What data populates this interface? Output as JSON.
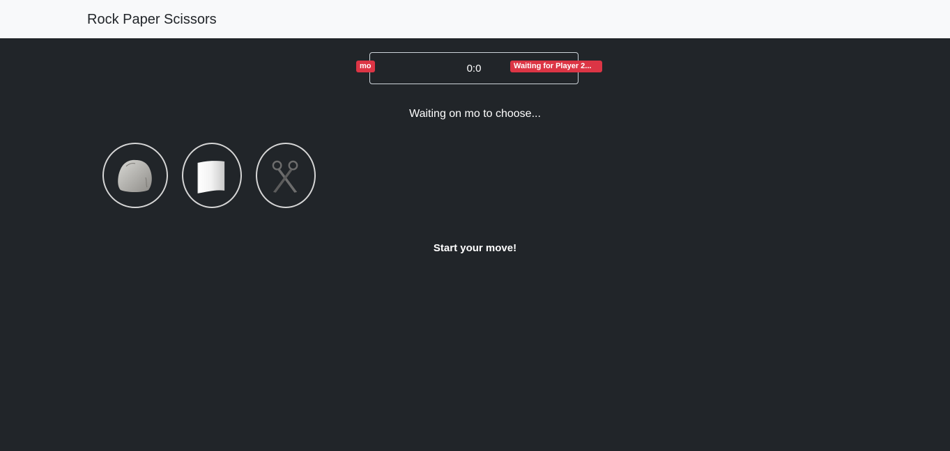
{
  "navbar": {
    "brand": "Rock Paper Scissors"
  },
  "scoreboard": {
    "player1_name": "mo",
    "score": "0:0",
    "player2_status": "Waiting for Player 2..."
  },
  "game": {
    "waiting_message": "Waiting on mo to choose...",
    "status_message": "Start your move!",
    "choices": [
      {
        "name": "rock",
        "icon": "rock-icon"
      },
      {
        "name": "paper",
        "icon": "paper-icon"
      },
      {
        "name": "scissors",
        "icon": "scissors-icon"
      }
    ]
  },
  "colors": {
    "background": "#212529",
    "navbar": "#f8f9fa",
    "badge": "#dc3545"
  }
}
